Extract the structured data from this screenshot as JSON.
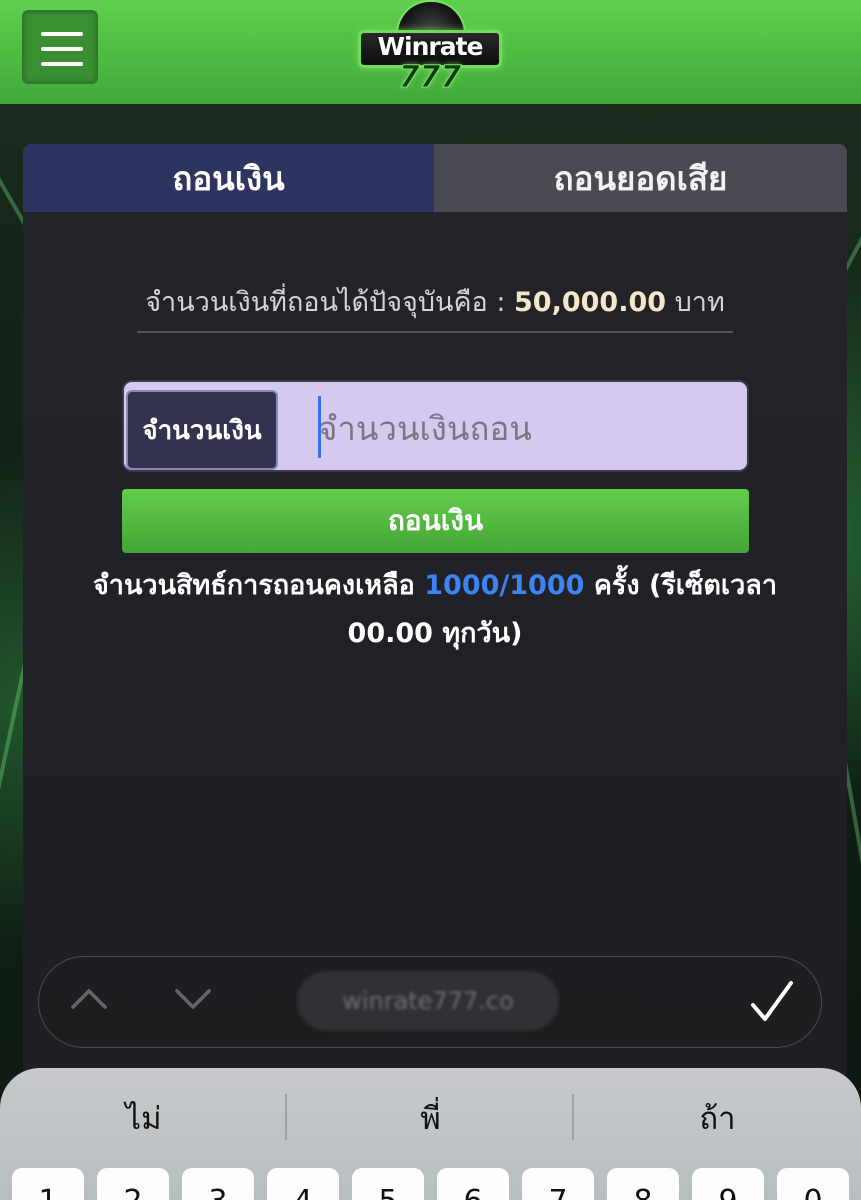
{
  "header": {
    "logo_word": "Winrate",
    "logo_number": "777",
    "menu_icon": "hamburger-menu-icon",
    "accent_color": "#4fbe42"
  },
  "tabs": [
    {
      "label": "ถอนเงิน",
      "active": true
    },
    {
      "label": "ถอนยอดเสีย",
      "active": false
    }
  ],
  "balance": {
    "prefix": "จำนวนเงินที่ถอนได้ปัจจุบันคือ : ",
    "amount": "50,000.00",
    "unit": "บาท"
  },
  "form": {
    "label": "จำนวนเงิน",
    "placeholder": "จำนวนเงินถอน",
    "value": "",
    "submit_label": "ถอนเงิน"
  },
  "quota": {
    "prefix": "จำนวนสิทธ์การถอนคงเหลือ ",
    "count": "1000/1000",
    "suffix": " ครั้ง (รีเซ็ตเวลา 00.00 ทุกวัน)"
  },
  "accessory_bar": {
    "url": "winrate777.co",
    "prev_icon": "chevron-up-icon",
    "next_icon": "chevron-down-icon",
    "done_icon": "checkmark-icon"
  },
  "keyboard": {
    "suggestions": [
      "ไม่",
      "พี่",
      "ถ้า"
    ],
    "number_keys": [
      "1",
      "2",
      "3",
      "4",
      "5",
      "6",
      "7",
      "8",
      "9",
      "0"
    ]
  }
}
